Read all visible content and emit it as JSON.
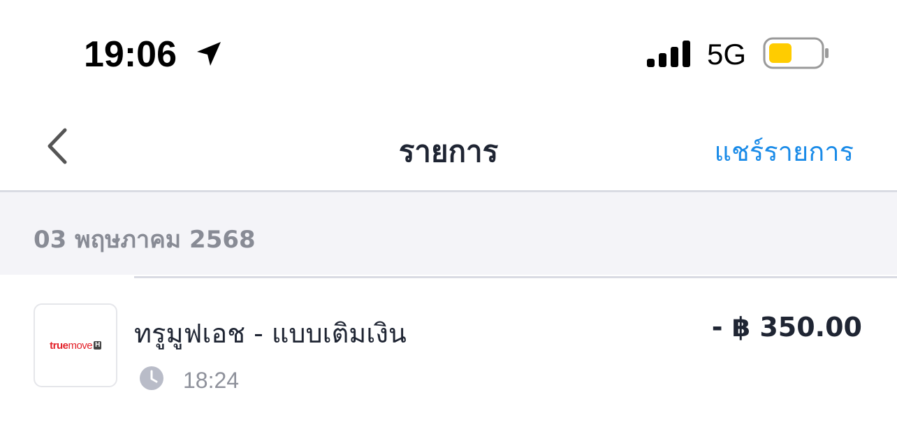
{
  "status_bar": {
    "time": "19:06",
    "network": "5G",
    "icons": {
      "location": "location-arrow-icon",
      "signal": "signal-bars-icon",
      "battery": "battery-icon"
    },
    "battery_color": "#ffcc00",
    "battery_level": 0.45
  },
  "nav": {
    "title": "รายการ",
    "share_label": "แชร์รายการ",
    "back_icon": "chevron-left-icon",
    "accent_color": "#1a8be8"
  },
  "transactions": {
    "date_header": "03 พฤษภาคม 2568",
    "items": [
      {
        "merchant_logo": "truemove-h-logo",
        "logo_text": {
          "true": "true",
          "move": "move",
          "badge": "H"
        },
        "title": "ทรูมูฟเอช - แบบเติมเงิน",
        "amount": "- ฿ 350.00",
        "time": "18:24",
        "time_icon": "clock-icon"
      }
    ]
  }
}
